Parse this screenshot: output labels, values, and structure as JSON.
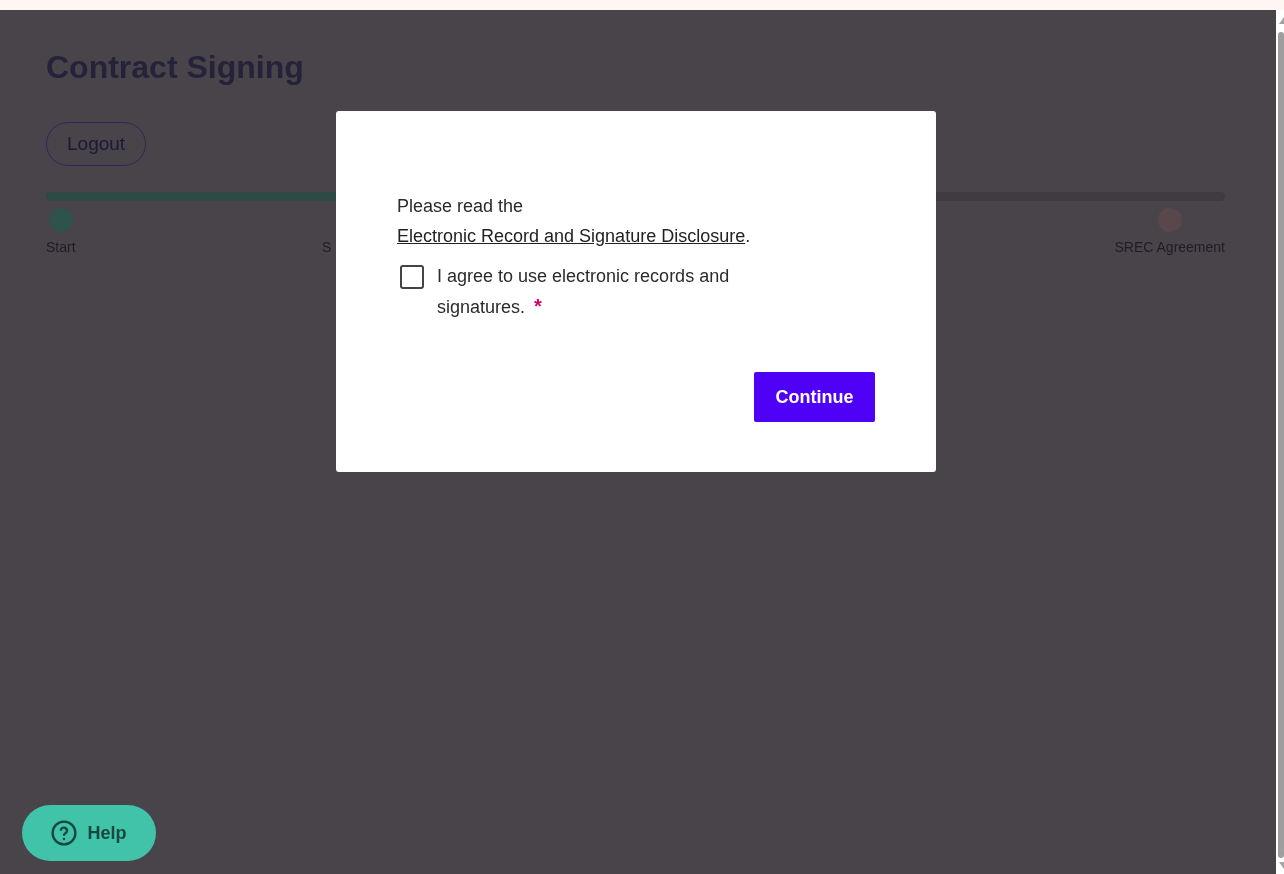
{
  "page": {
    "title": "Contract Signing",
    "logout_button": "Logout",
    "progress": {
      "level": 0.25,
      "steps": [
        {
          "label": "Start",
          "completed": true
        },
        {
          "label": "S"
        },
        {
          "label": "SREC Agreement",
          "completed": false
        }
      ]
    }
  },
  "dialog": {
    "text_before_link": "Please read the",
    "link": "Electronic Record and Signature Disclosure",
    "text_after_link": ".",
    "consent": {
      "label": "I agree to use electronic records and signatures.",
      "checked": false,
      "required_mark": "*"
    },
    "button": "Continue"
  },
  "help_button": "Help"
}
